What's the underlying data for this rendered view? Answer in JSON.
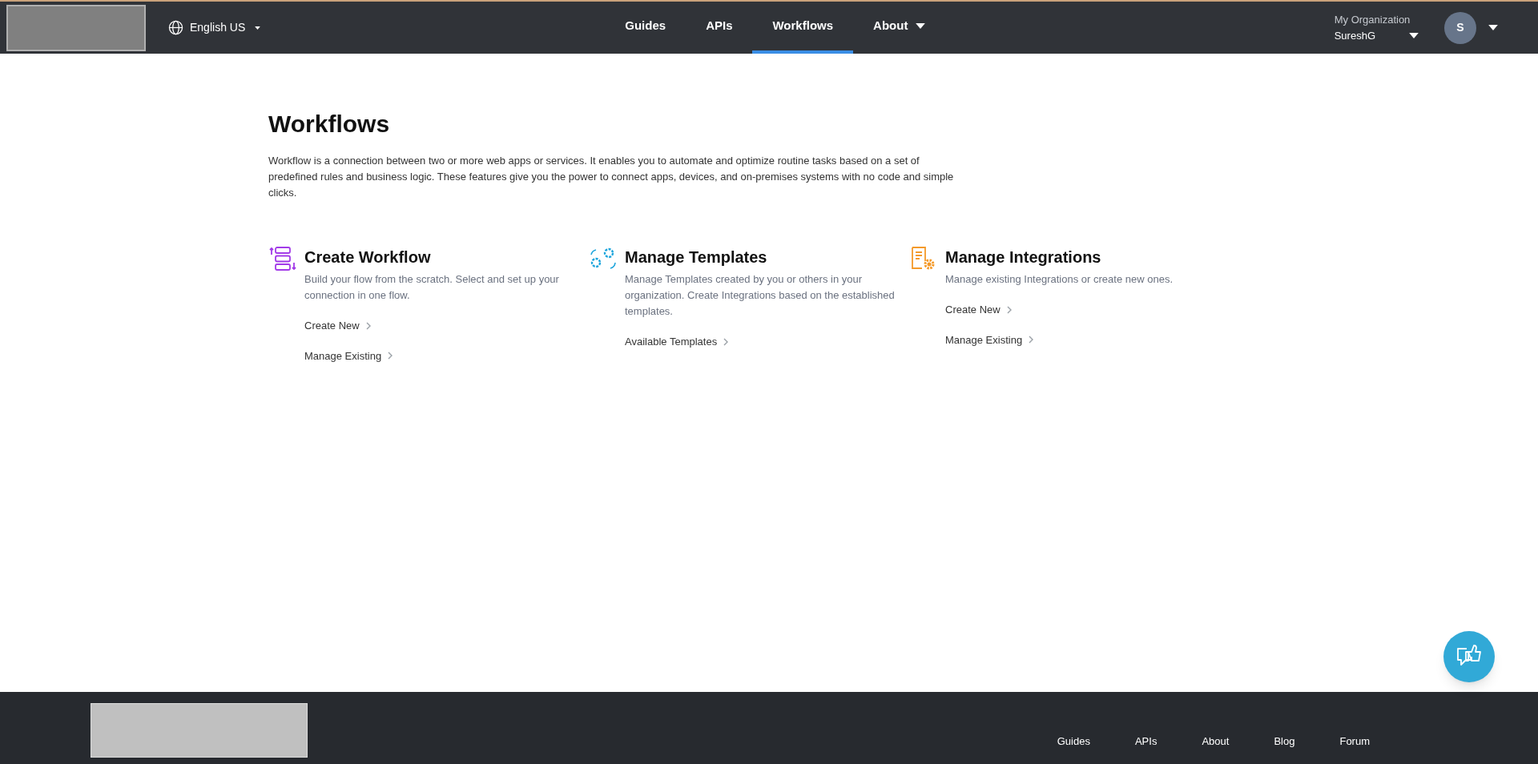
{
  "header": {
    "language": "English US",
    "nav": [
      {
        "label": "Guides",
        "selected": false,
        "dropdown": false
      },
      {
        "label": "APIs",
        "selected": false,
        "dropdown": false
      },
      {
        "label": "Workflows",
        "selected": true,
        "dropdown": false
      },
      {
        "label": "About",
        "selected": false,
        "dropdown": true
      }
    ],
    "organization_label": "My Organization",
    "organization": "SureshG",
    "avatar": "S"
  },
  "page": {
    "title": "Workflows",
    "description": "Workflow is a connection between two or more web apps or services. It enables you to automate and optimize routine tasks based on a set of predefined rules and business logic. These features give you the power to connect apps, devices, and on-premises systems with no code and simple clicks."
  },
  "cards": [
    {
      "kind": "list",
      "title": "Create Workflow",
      "description": "Build your flow from the scratch. Select and set up your connection in one flow.",
      "links": [
        "Create New",
        "Manage Existing"
      ]
    },
    {
      "kind": "gears",
      "title": "Manage Templates",
      "description": "Manage Templates created by you or others in your organization. Create Integrations based on the established templates.",
      "links": [
        "Available Templates"
      ]
    },
    {
      "kind": "document",
      "title": "Manage Integrations",
      "description": "Manage existing Integrations or create new ones.",
      "links": [
        "Create New",
        "Manage Existing"
      ]
    }
  ],
  "footer": {
    "links": [
      "Guides",
      "APIs",
      "About",
      "Blog",
      "Forum"
    ]
  }
}
